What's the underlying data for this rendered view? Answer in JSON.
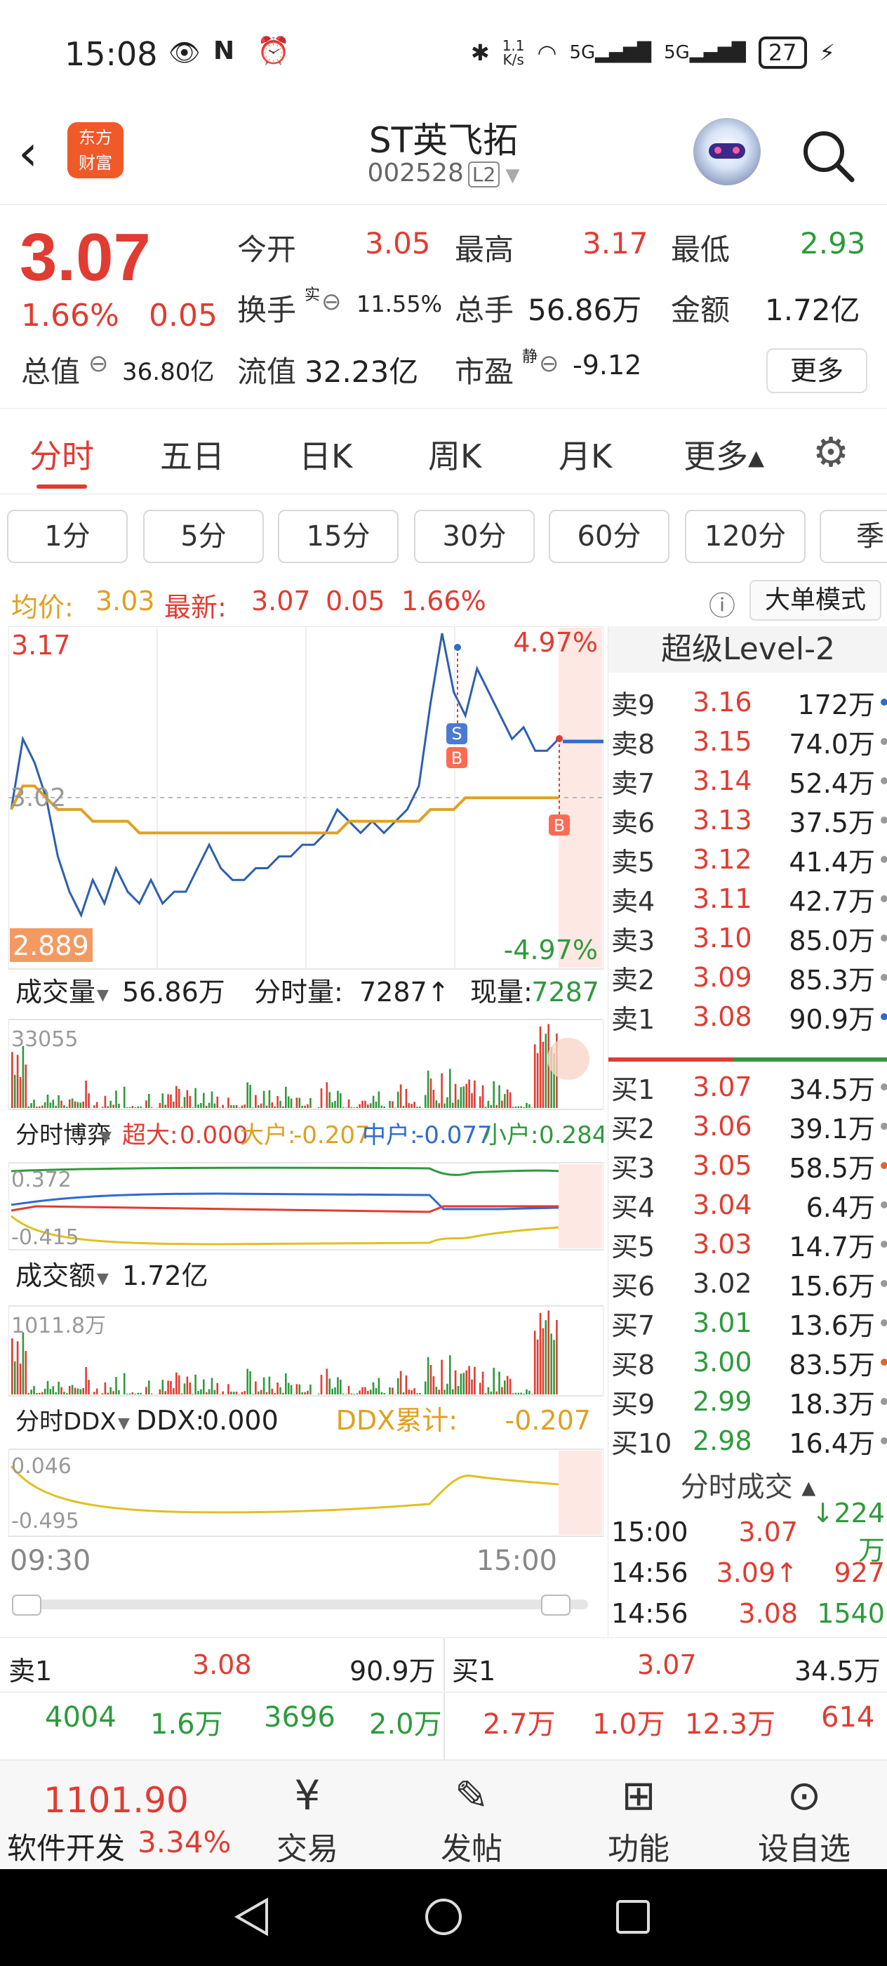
{
  "status_bar": {
    "time": "15:08",
    "net_speed_top": "1.1",
    "net_speed_unit": "K/s",
    "signal1": "5G",
    "signal2": "5G",
    "battery": "27"
  },
  "header": {
    "logo_line1": "东方",
    "logo_line2": "财富",
    "stock_name": "ST英飞拓",
    "stock_code": "002528",
    "level_tag": "L2"
  },
  "quote": {
    "price": "3.07",
    "change_pct": "1.66%",
    "change_val": "0.05",
    "open_label": "今开",
    "open": "3.05",
    "high_label": "最高",
    "high": "3.17",
    "low_label": "最低",
    "low": "2.93",
    "turnover_label": "换手",
    "turnover_sup": "实",
    "turnover": "11.55%",
    "volume_label": "总手",
    "volume": "56.86万",
    "amount_label": "金额",
    "amount": "1.72亿",
    "mktcap_label": "总值",
    "mktcap": "36.80亿",
    "float_label": "流值",
    "float_cap": "32.23亿",
    "pe_label": "市盈",
    "pe_sup": "静",
    "pe": "-9.12",
    "more_label": "更多"
  },
  "tabs": [
    {
      "label": "分时",
      "active": true
    },
    {
      "label": "五日"
    },
    {
      "label": "日K"
    },
    {
      "label": "周K"
    },
    {
      "label": "月K"
    },
    {
      "label": "更多▴"
    }
  ],
  "periods": [
    "1分",
    "5分",
    "15分",
    "30分",
    "60分",
    "120分",
    "季"
  ],
  "info_bar": {
    "avg_label": "均价:",
    "avg": "3.03",
    "latest_label": "最新:",
    "latest": "3.07",
    "chg": "0.05",
    "pct": "1.66%",
    "mode_btn": "大单模式"
  },
  "chart_labels": {
    "price_high": "3.17",
    "price_low": "2.889",
    "pct_high": "4.97%",
    "pct_low": "-4.97%",
    "mid_price": "3.02",
    "vol_label": "成交量",
    "vol_total": "56.86万",
    "vol_tick_label": "分时量:",
    "vol_tick": "7287↑",
    "vol_now_label": "现量:",
    "vol_now": "7287",
    "vol_max": "33055",
    "game_label": "分时博弈",
    "super_label": "超大:",
    "super_val": "0.000",
    "big_label": "大户:",
    "big_val": "-0.207",
    "mid_label": "中户:",
    "mid_val": "-0.077",
    "small_label": "小户:",
    "small_val": "0.284",
    "game_max": "0.372",
    "game_min": "-0.415",
    "amt_label": "成交额",
    "amt_total": "1.72亿",
    "amt_max": "1011.8万",
    "ddx_label": "分时DDX",
    "ddx_val_label": "DDX:",
    "ddx_val": "0.000",
    "ddx_cum_label": "DDX累计:",
    "ddx_cum": "-0.207",
    "ddx_max": "0.046",
    "ddx_min": "-0.495",
    "time_start": "09:30",
    "time_end": "15:00",
    "marker_s": "S",
    "marker_b": "B"
  },
  "chart_data": {
    "type": "line",
    "x_range": [
      "09:30",
      "15:00"
    ],
    "ylim": [
      2.889,
      3.17
    ],
    "series": [
      {
        "values": [
          3.02,
          3.08,
          3.06,
          3.03,
          2.98,
          2.95,
          2.93,
          2.96,
          2.94,
          2.97,
          2.95,
          2.94,
          2.96,
          2.94,
          2.95,
          2.95,
          2.97,
          2.99,
          2.97,
          2.96,
          2.96,
          2.97,
          2.97,
          2.98,
          2.98,
          2.99,
          2.99,
          3.0,
          3.02,
          3.01,
          3.0,
          3.01,
          3.0,
          3.01,
          3.02,
          3.04,
          3.11,
          3.17,
          3.12,
          3.1,
          3.14,
          3.12,
          3.1,
          3.08,
          3.09,
          3.07,
          3.07,
          3.08
        ]
      },
      {
        "values": [
          3.02,
          3.04,
          3.04,
          3.03,
          3.02,
          3.02,
          3.02,
          3.01,
          3.01,
          3.01,
          3.01,
          3.0,
          3.0,
          3.0,
          3.0,
          3.0,
          3.0,
          3.0,
          3.0,
          3.0,
          3.0,
          3.0,
          3.0,
          3.0,
          3.0,
          3.0,
          3.0,
          3.0,
          3.0,
          3.01,
          3.01,
          3.01,
          3.01,
          3.01,
          3.01,
          3.01,
          3.02,
          3.02,
          3.02,
          3.03,
          3.03,
          3.03,
          3.03,
          3.03,
          3.03,
          3.03,
          3.03,
          3.03
        ]
      }
    ]
  },
  "level2": {
    "title": "超级Level-2",
    "asks": [
      {
        "name": "卖9",
        "price": "3.16",
        "vol": "172万",
        "dot": "#2d6bd0"
      },
      {
        "name": "卖8",
        "price": "3.15",
        "vol": "74.0万",
        "dot": "#999"
      },
      {
        "name": "卖7",
        "price": "3.14",
        "vol": "52.4万",
        "dot": "#999"
      },
      {
        "name": "卖6",
        "price": "3.13",
        "vol": "37.5万",
        "dot": "#999"
      },
      {
        "name": "卖5",
        "price": "3.12",
        "vol": "41.4万",
        "dot": "#999"
      },
      {
        "name": "卖4",
        "price": "3.11",
        "vol": "42.7万",
        "dot": "#999"
      },
      {
        "name": "卖3",
        "price": "3.10",
        "vol": "85.0万",
        "dot": "#999"
      },
      {
        "name": "卖2",
        "price": "3.09",
        "vol": "85.3万",
        "dot": "#999"
      },
      {
        "name": "卖1",
        "price": "3.08",
        "vol": "90.9万",
        "dot": "#2d6bd0"
      }
    ],
    "bids": [
      {
        "name": "买1",
        "price": "3.07",
        "vol": "34.5万",
        "dot": "#999",
        "color": "#e03c32"
      },
      {
        "name": "买2",
        "price": "3.06",
        "vol": "39.1万",
        "dot": "#999",
        "color": "#e03c32"
      },
      {
        "name": "买3",
        "price": "3.05",
        "vol": "58.5万",
        "dot": "#e0662a",
        "color": "#e03c32"
      },
      {
        "name": "买4",
        "price": "3.04",
        "vol": "6.4万",
        "dot": "#999",
        "color": "#e03c32"
      },
      {
        "name": "买5",
        "price": "3.03",
        "vol": "14.7万",
        "dot": "#999",
        "color": "#e03c32"
      },
      {
        "name": "买6",
        "price": "3.02",
        "vol": "15.6万",
        "dot": "#999",
        "color": "#333"
      },
      {
        "name": "买7",
        "price": "3.01",
        "vol": "13.6万",
        "dot": "#999",
        "color": "#2e9a3c"
      },
      {
        "name": "买8",
        "price": "3.00",
        "vol": "83.5万",
        "dot": "#e0662a",
        "color": "#2e9a3c"
      },
      {
        "name": "买9",
        "price": "2.99",
        "vol": "18.3万",
        "dot": "#999",
        "color": "#2e9a3c"
      },
      {
        "name": "买10",
        "price": "2.98",
        "vol": "16.4万",
        "dot": "#999",
        "color": "#2e9a3c"
      }
    ],
    "trades_title": "分时成交 ▴",
    "trades": [
      {
        "time": "15:00",
        "price": "3.07",
        "vol": "↓224万",
        "pcolor": "#e03c32",
        "vcolor": "#2e9a3c"
      },
      {
        "time": "14:56",
        "price": "3.09↑",
        "vol": "927",
        "pcolor": "#e03c32",
        "vcolor": "#e03c32"
      },
      {
        "time": "14:56",
        "price": "3.08",
        "vol": "1540",
        "pcolor": "#e03c32",
        "vcolor": "#2e9a3c"
      }
    ]
  },
  "bottom_quote": {
    "ask_label": "卖1",
    "ask_price": "3.08",
    "ask_vol": "90.9万",
    "bid_label": "买1",
    "bid_price": "3.07",
    "bid_vol": "34.5万",
    "row1": [
      "4004",
      "1.6万",
      "3696",
      "2.0万",
      "2.7万",
      "1.0万",
      "12.3万",
      "614"
    ]
  },
  "nav": {
    "index_value": "1101.90",
    "index_name": "软件开发",
    "index_pct": "3.34%",
    "items": [
      "交易",
      "发帖",
      "功能",
      "设自选"
    ]
  }
}
